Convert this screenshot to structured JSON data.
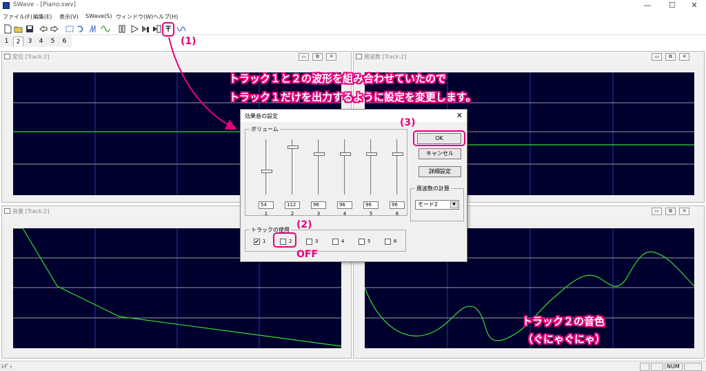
{
  "window": {
    "title": "SWave - [Piano.swv]",
    "minimize": "—",
    "maximize": "☐",
    "close": "✕"
  },
  "menu": [
    "ファイル(F)",
    "編集(E)",
    "表示(V)",
    "SWave(S)",
    "ウィンドウ(W)",
    "ヘルプ(H)"
  ],
  "track_tabs": [
    "1",
    "2",
    "3",
    "4",
    "5",
    "6"
  ],
  "active_tab": "2",
  "panels": {
    "top_left": "定位 [Track:2]",
    "top_right": "周波数 [Track:2]",
    "bottom_left": "音量 [Track:2]"
  },
  "dialog": {
    "title": "効果音の設定",
    "close": "✕",
    "volume_group": "ボリューム",
    "sliders": [
      {
        "label": "1",
        "value": "54",
        "level": 0.42
      },
      {
        "label": "2",
        "value": "112",
        "level": 0.88
      },
      {
        "label": "3",
        "value": "96",
        "level": 0.75
      },
      {
        "label": "4",
        "value": "96",
        "level": 0.75
      },
      {
        "label": "5",
        "value": "96",
        "level": 0.75
      },
      {
        "label": "6",
        "value": "96",
        "level": 0.75
      }
    ],
    "ok": "OK",
    "cancel": "キャンセル",
    "details": "詳細設定",
    "freq_group": "周波数の計算",
    "mode_value": "モード2",
    "mode_arrow": "▼",
    "track_use_group": "トラックの使用",
    "tracks": [
      {
        "label": "1",
        "checked": true,
        "mark": "✔"
      },
      {
        "label": "2",
        "checked": false,
        "mark": ""
      },
      {
        "label": "3",
        "checked": false,
        "mark": ""
      },
      {
        "label": "4",
        "checked": false,
        "mark": ""
      },
      {
        "label": "5",
        "checked": false,
        "mark": ""
      },
      {
        "label": "6",
        "checked": false,
        "mark": ""
      }
    ]
  },
  "annotations": {
    "step1": "(1)",
    "step2": "(2)",
    "step3": "(3)",
    "off": "OFF",
    "headline_line1": "トラック１と２の波形を組み合わせていたので",
    "headline_line2": "トラック１だけを出力するように設定を変更します。",
    "timbre_line1": "トラック２の音色",
    "timbre_line2": "（ぐにゃぐにゃ）",
    "accent_color": "#e6007e"
  },
  "status": {
    "left": "ﾚﾃﾞｨ",
    "num": "NUM"
  },
  "colors": {
    "plot_bg": "#00002e",
    "grid_blue": "#1e3caa",
    "grid_gray": "#9a9aa8",
    "wave_green": "#33dd33"
  }
}
